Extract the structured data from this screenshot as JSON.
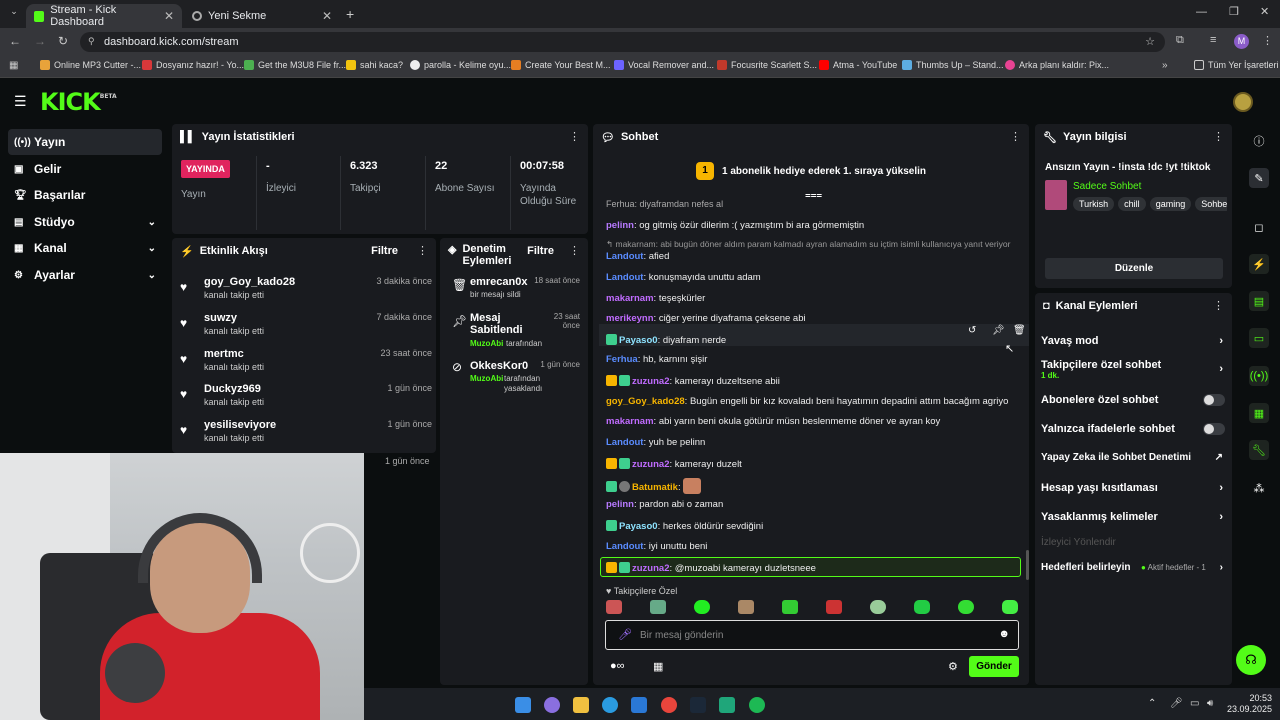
{
  "browser": {
    "tabs": [
      {
        "label": "Stream - Kick Dashboard",
        "active": true
      },
      {
        "label": "Yeni Sekme",
        "active": false
      }
    ],
    "url": "dashboard.kick.com/stream",
    "bookmarks": [
      "Online MP3 Cutter -...",
      "Dosyanız hazır! - Yo...",
      "Get the M3U8 File fr...",
      "sahi kaca?",
      "parolla - Kelime oyu...",
      "Create Your Best M...",
      "Vocal Remover and...",
      "Focusrite Scarlett S...",
      "Atma - YouTube",
      "Thumbs Up – Stand...",
      "Arka planı kaldır: Pix..."
    ],
    "all_bookmarks": "Tüm Yer İşaretleri",
    "profile_initial": "M"
  },
  "brand": {
    "logo": "KICK",
    "beta": "BETA",
    "accent": "#53fc18"
  },
  "sidebar": {
    "items": [
      {
        "label": "Yayın",
        "icon": "broadcast-icon",
        "active": true
      },
      {
        "label": "Gelir",
        "icon": "wallet-icon"
      },
      {
        "label": "Başarılar",
        "icon": "trophy-icon"
      },
      {
        "label": "Stüdyo",
        "icon": "studio-icon",
        "chevron": true
      },
      {
        "label": "Kanal",
        "icon": "channel-icon",
        "chevron": true
      },
      {
        "label": "Ayarlar",
        "icon": "gear-icon",
        "chevron": true
      }
    ]
  },
  "stats": {
    "title": "Yayın İstatistikleri",
    "live": "YAYINDA",
    "live_label": "Yayın",
    "items": [
      {
        "value": "-",
        "label": "İzleyici"
      },
      {
        "value": "6.323",
        "label": "Takipçi"
      },
      {
        "value": "22",
        "label": "Abone Sayısı"
      },
      {
        "value": "00:07:58",
        "label": "Yayında Olduğu Süre"
      }
    ]
  },
  "activity": {
    "title": "Etkinlik Akışı",
    "filter": "Filtre",
    "events": [
      {
        "name": "goy_Goy_kado28",
        "sub": "kanalı takip etti",
        "time": "3 dakika önce"
      },
      {
        "name": "suwzy",
        "sub": "kanalı takip etti",
        "time": "7 dakika önce"
      },
      {
        "name": "mertmc",
        "sub": "kanalı takip etti",
        "time": "23 saat önce"
      },
      {
        "name": "Duckyz969",
        "sub": "kanalı takip etti",
        "time": "1 gün önce"
      },
      {
        "name": "yesiliseviyore",
        "sub": "kanalı takip etti",
        "time": "1 gün önce"
      }
    ],
    "extra_time": "1 gün önce"
  },
  "moderation": {
    "title": "Denetim Eylemleri",
    "filter": "Filtre",
    "items": [
      {
        "name": "emrecan0x",
        "sub": "bir mesajı sildi",
        "time": "18 saat önce"
      },
      {
        "name": "Mesaj Sabitlendi",
        "by": "MuzoAbi",
        "sub": "tarafından",
        "time": "23 saat önce"
      },
      {
        "name": "OkkesKor0",
        "by": "MuzoAbi",
        "sub": "tarafından yasaklandı",
        "time": "1 gün önce"
      }
    ]
  },
  "chat": {
    "title": "Sohbet",
    "promo_num": "1",
    "promo": "1 abonelik hediye ederek 1. sıraya yükselin",
    "messages": [
      {
        "user": "pelinn",
        "color": "#b77aff",
        "text": "og gitmiş özür dilerim :( yazmıştım bi ara görmemiştin"
      },
      {
        "reply": "makarnam: abi bugün döner aldım param kalmadı ayran alamadım su içtim isimli kullanıcıya yanıt veriyor",
        "user": "Landout",
        "color": "#5a8cff",
        "text": "afied"
      },
      {
        "user": "Landout",
        "color": "#5a8cff",
        "text": "konuşmayıda unuttu adam"
      },
      {
        "user": "makarnam",
        "color": "#c06cff",
        "text": "teşeşkürler"
      },
      {
        "user": "merikeynn",
        "color": "#c06cff",
        "text": "ciğer yerine diyaframa çeksene abi"
      },
      {
        "user": "Payaso0",
        "color": "#8ee3ff",
        "text": "diyafram nerde"
      },
      {
        "user": "Ferhua",
        "color": "#5a8cff",
        "text": "hb, karnını şişir"
      },
      {
        "user": "zuzuna2",
        "color": "#c06cff",
        "text": "kamerayı duzeltsene abii"
      },
      {
        "user": "goy_Goy_kado28",
        "color": "#f7b500",
        "text": "Bugün engelli bir kız kovaladı beni hayatımın depadini attım bacağım agriyo"
      },
      {
        "user": "makarnam",
        "color": "#c06cff",
        "text": "abi yarın beni okula götürür müsn beslenmeme döner ve ayran koy"
      },
      {
        "user": "Landout",
        "color": "#5a8cff",
        "text": "yuh be pelinn"
      },
      {
        "user": "zuzuna2",
        "color": "#c06cff",
        "text": "kamerayı duzelt"
      },
      {
        "user": "Batumatik",
        "color": "#f7b500",
        "text": ""
      },
      {
        "user": "pelinn",
        "color": "#b77aff",
        "text": "pardon abi o zaman"
      },
      {
        "user": "Payaso0",
        "color": "#8ee3ff",
        "text": "herkes öldürür sevdiğini"
      },
      {
        "user": "Landout",
        "color": "#5a8cff",
        "text": "iyi unuttu beni"
      },
      {
        "user": "zuzuna2",
        "color": "#c06cff",
        "text": "@muzoabi kamerayı duzletsneee"
      }
    ],
    "emote_label": "Takipçilere Özel",
    "placeholder": "Bir mesaj gönderin",
    "send": "Gönder"
  },
  "streaminfo": {
    "title": "Yayın bilgisi",
    "stream_title": "Ansızın Yayın - !insta !dc !yt !tiktok",
    "category": "Sadece Sohbet",
    "tags": [
      "Turkish",
      "chill",
      "gaming",
      "Sohbe"
    ],
    "edit": "Düzenle"
  },
  "channel_actions": {
    "title": "Kanal Eylemleri",
    "items": [
      {
        "label": "Yavaş mod",
        "type": "chevron"
      },
      {
        "label": "Takipçilere özel sohbet",
        "sub": "1 dk.",
        "type": "chevron"
      },
      {
        "label": "Abonelere özel sohbet",
        "type": "toggle"
      },
      {
        "label": "Yalnızca ifadelerle sohbet",
        "type": "toggle"
      },
      {
        "label": "Yapay Zeka ile Sohbet Denetimi",
        "type": "external"
      },
      {
        "label": "Hesap yaşı kısıtlaması",
        "type": "chevron"
      },
      {
        "label": "Yasaklanmış kelimeler",
        "type": "chevron"
      },
      {
        "label": "İzleyici Yönlendir",
        "type": "disabled"
      },
      {
        "label": "Hedefleri belirleyin",
        "sub": "Aktif hedefler - 1",
        "type": "chevron"
      }
    ]
  },
  "taskbar": {
    "time": "20:53",
    "date": "23.09.2025"
  }
}
